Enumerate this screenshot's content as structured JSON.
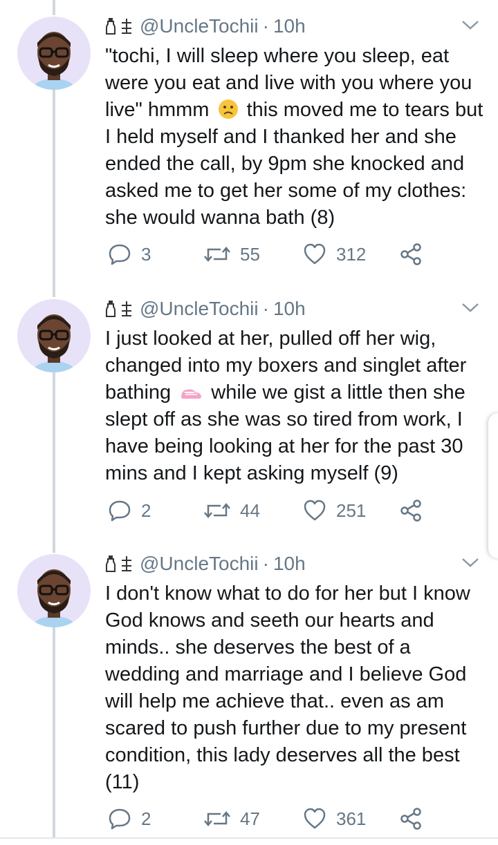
{
  "tweets": [
    {
      "handle": "@UncleTochii",
      "separator": "·",
      "time": "10h",
      "text_a": "\"tochi, I will sleep where you sleep, eat were you eat and live with you where you live\"  hmmm ",
      "emoji": "worried-face-emoji",
      "text_b": " this moved me to tears but I held myself and I thanked her and she ended the call, by 9pm she knocked and asked me to get her some of my clothes: she would wanna bath  (8)",
      "replies": "3",
      "retweets": "55",
      "likes": "312"
    },
    {
      "handle": "@UncleTochii",
      "separator": "·",
      "time": "10h",
      "text_a": "I just looked at her, pulled off her wig, changed into my boxers and singlet after bathing ",
      "emoji": "pink-shoe-emoji",
      "text_b": " while we gist a little then she slept off as she was so tired from work, I have being looking at her for the past 30 mins and I kept asking myself (9)",
      "replies": "2",
      "retweets": "44",
      "likes": "251"
    },
    {
      "handle": "@UncleTochii",
      "separator": "·",
      "time": "10h",
      "text_a": "I don't know what to do for her but I know God knows and seeth our hearts and minds.. she deserves the best of a wedding and marriage and I believe God will help me achieve that.. even as am scared to push further due to my present condition, this lady deserves all the best (11)",
      "emoji": "",
      "text_b": "",
      "replies": "2",
      "retweets": "47",
      "likes": "361"
    }
  ],
  "icons": {
    "reply": "reply-icon",
    "retweet": "retweet-icon",
    "like": "heart-icon",
    "share": "share-icon",
    "more": "chevron-down-icon",
    "badge_1": "bottle-emoji-badge",
    "badge_2": "scales-emoji-badge"
  },
  "colors": {
    "text": "#14171a",
    "muted": "#657786",
    "thread_line": "#d0d8de",
    "avatar_bg": "#e8e2f8"
  }
}
